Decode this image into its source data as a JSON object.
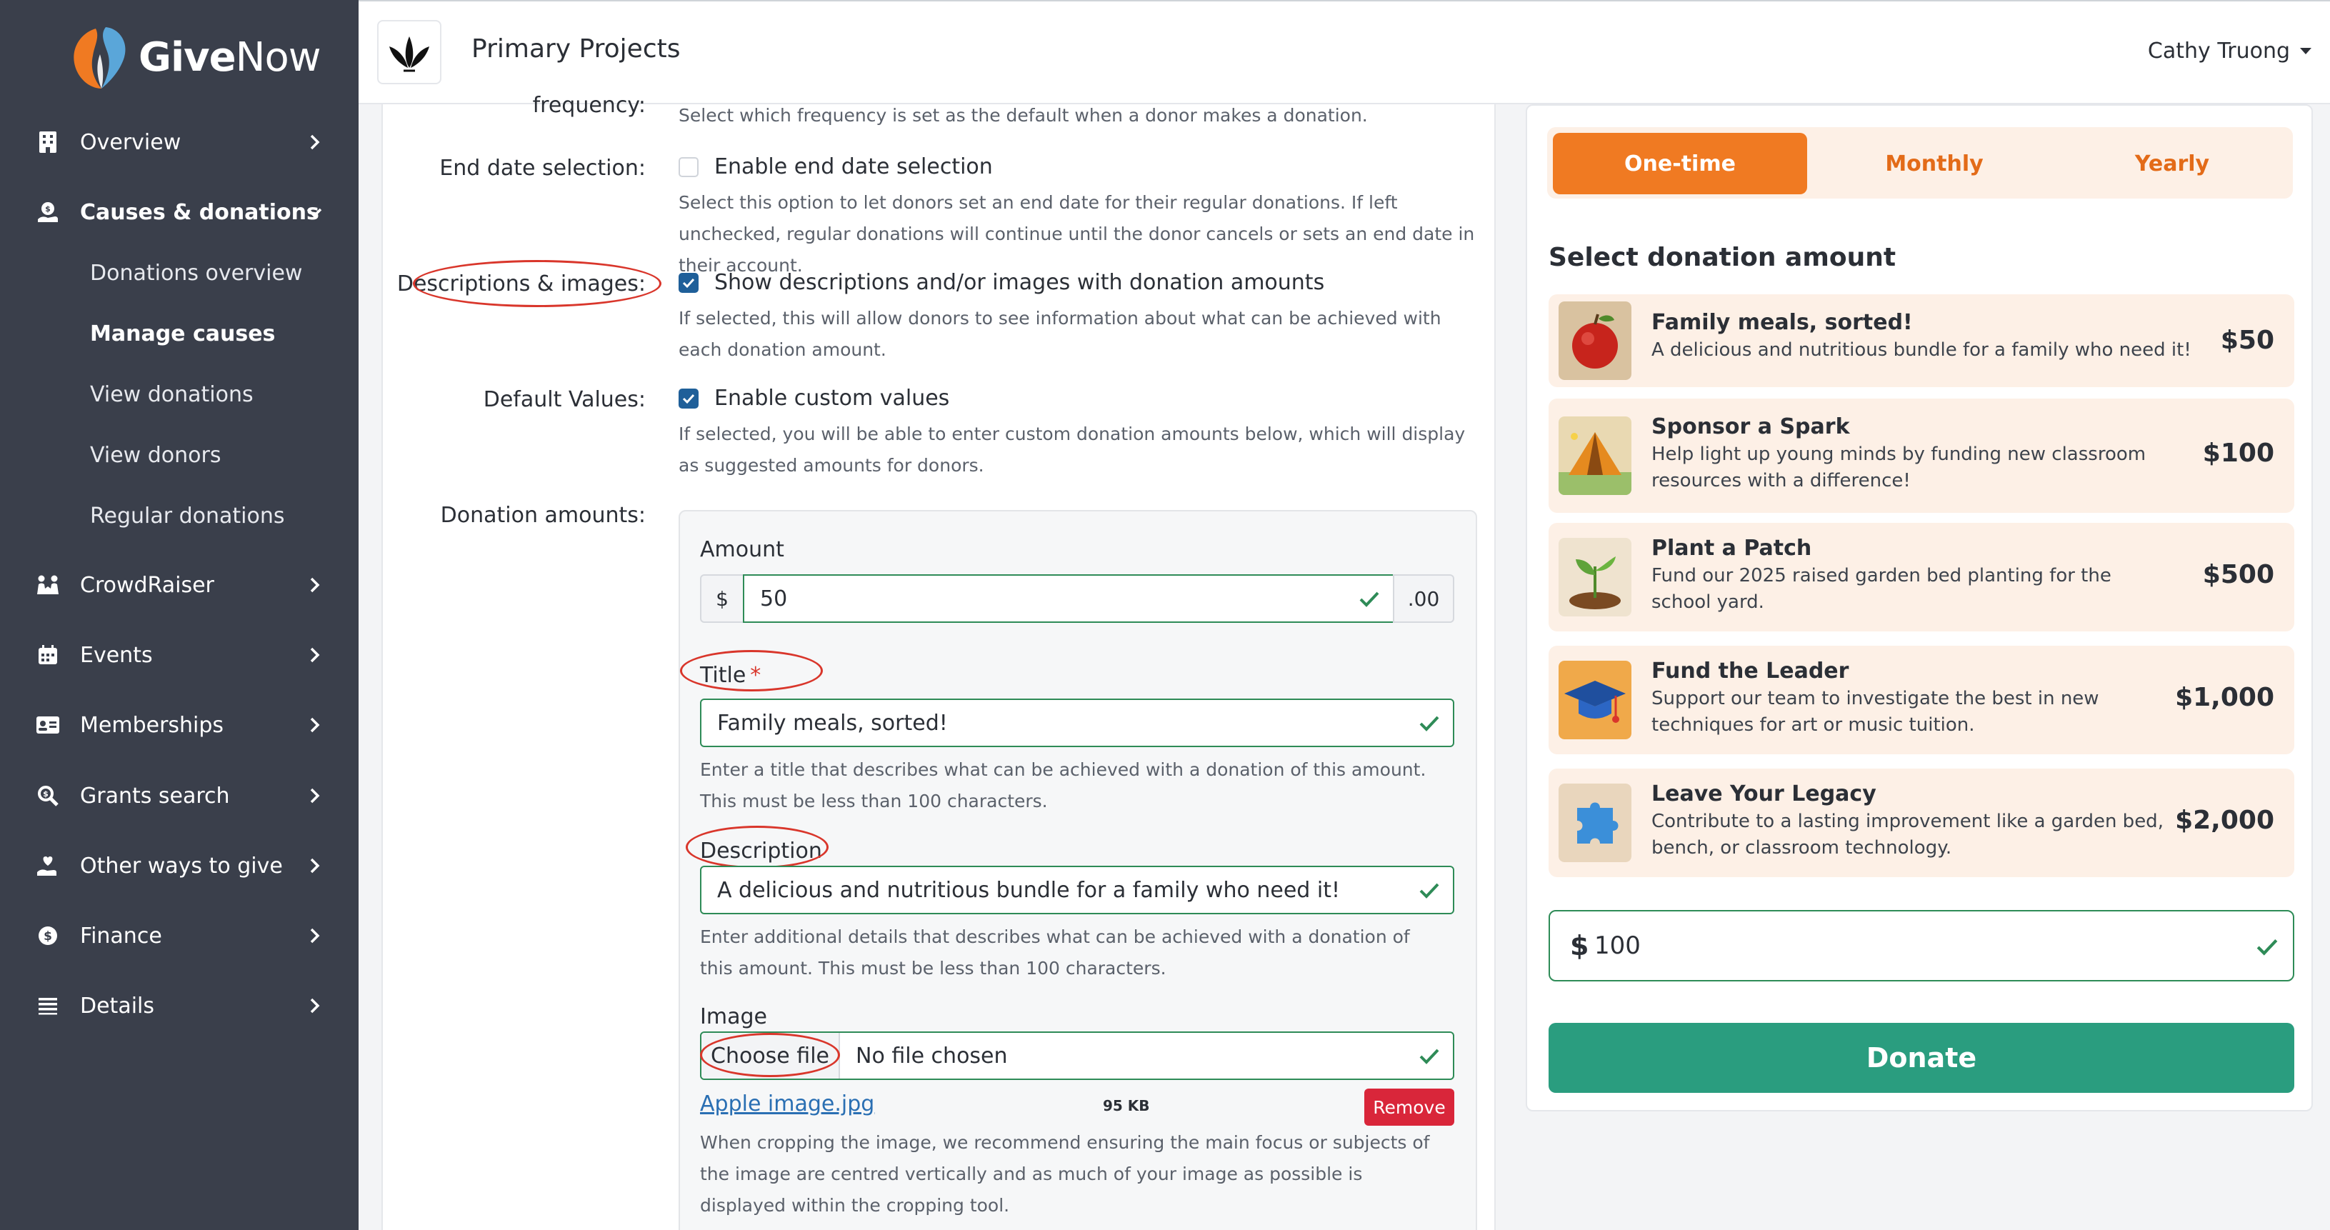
{
  "brand": {
    "name_bold": "Give",
    "name_rest": "Now"
  },
  "sidebar": {
    "items": [
      {
        "label": "Overview"
      },
      {
        "label": "Causes & donations"
      },
      {
        "label": "CrowdRaiser"
      },
      {
        "label": "Events"
      },
      {
        "label": "Memberships"
      },
      {
        "label": "Grants search"
      },
      {
        "label": "Other ways to give"
      },
      {
        "label": "Finance"
      },
      {
        "label": "Details"
      }
    ],
    "subitems": [
      {
        "label": "Donations overview"
      },
      {
        "label": "Manage causes"
      },
      {
        "label": "View donations"
      },
      {
        "label": "View donors"
      },
      {
        "label": "Regular donations"
      }
    ]
  },
  "header": {
    "title": "Primary Projects",
    "user": "Cathy Truong"
  },
  "form": {
    "frequency_label": "frequency:",
    "frequency_help": "Select which frequency is set as the default when a donor makes a donation.",
    "end_date_label": "End date selection:",
    "end_date_checkbox": "Enable end date selection",
    "end_date_help": "Select this option to let donors set an end date for their regular donations. If left unchecked, regular donations will continue until the donor cancels or sets an end date in their account.",
    "desc_images_label": "Descriptions & images:",
    "desc_images_checkbox": "Show descriptions and/or images with donation amounts",
    "desc_images_help": "If selected, this will allow donors to see information about what can be achieved with each donation amount.",
    "default_values_label": "Default Values:",
    "default_values_checkbox": "Enable custom values",
    "default_values_help": "If selected, you will be able to enter custom donation amounts below, which will display as suggested amounts for donors.",
    "donation_amounts_label": "Donation amounts:",
    "amount": {
      "label": "Amount",
      "currency": "$",
      "value": "50",
      "cents": ".00"
    },
    "title_field": {
      "label": "Title",
      "required_mark": "*",
      "value": "Family meals, sorted!",
      "help": "Enter a title that describes what can be achieved with a donation of this amount. This must be less than 100 characters."
    },
    "description_field": {
      "label": "Description",
      "value": "A delicious and nutritious bundle for a family who need it!",
      "help": "Enter additional details that describes what can be achieved with a donation of this amount. This must be less than 100 characters."
    },
    "image_field": {
      "label": "Image",
      "choose_label": "Choose file",
      "file_status": "No file chosen",
      "file_name": "Apple image.jpg",
      "file_size": "95 KB",
      "remove_label": "Remove",
      "help": "When cropping the image, we recommend ensuring the main focus or subjects of the image are centred vertically and as much of your image as possible is displayed within the cropping tool."
    }
  },
  "preview": {
    "tabs": [
      {
        "label": "One-time"
      },
      {
        "label": "Monthly"
      },
      {
        "label": "Yearly"
      }
    ],
    "select_title": "Select donation amount",
    "tiers": [
      {
        "title": "Family meals, sorted!",
        "desc": "A delicious and nutritious bundle for a family who need it!",
        "amount": "$50",
        "image": "apple-image"
      },
      {
        "title": "Sponsor a Spark",
        "desc": "Help light up young minds by funding new classroom resources with a difference!",
        "amount": "$100",
        "image": "tent-image"
      },
      {
        "title": "Plant a Patch",
        "desc": "Fund our 2025 raised garden bed planting for the school yard.",
        "amount": "$500",
        "image": "seedling-image"
      },
      {
        "title": "Fund the Leader",
        "desc": "Support our team to investigate the best in new techniques for art or music tuition.",
        "amount": "$1,000",
        "image": "graduation-cap-image"
      },
      {
        "title": "Leave Your Legacy",
        "desc": "Contribute to a lasting improvement like a garden bed, bench, or classroom technology.",
        "amount": "$2,000",
        "image": "puzzle-piece-image"
      }
    ],
    "custom_currency": "$",
    "custom_value": "100",
    "donate_label": "Donate"
  },
  "colors": {
    "sidebar_bg": "#3a3f4b",
    "accent_orange": "#f07a22",
    "tier_bg": "#fdf0e6",
    "donate_green": "#2a9d7f",
    "valid_green": "#2e8b57",
    "annotation_red": "#d9362b",
    "remove_red": "#d9263a"
  }
}
